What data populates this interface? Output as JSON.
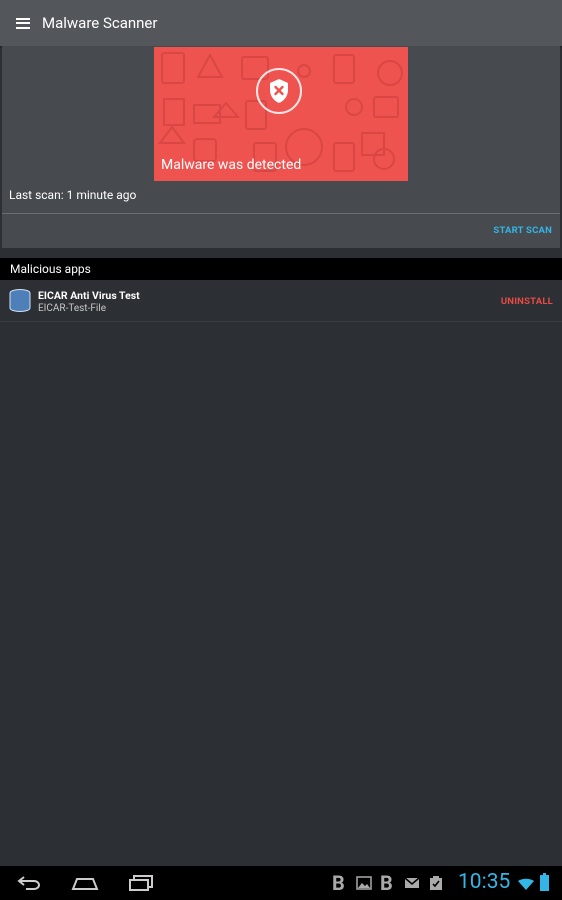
{
  "app_bar": {
    "title": "Malware Scanner",
    "menu_icon": "hamburger-menu-icon"
  },
  "status_card": {
    "banner_text": "Malware was detected",
    "banner_color": "#ef5350",
    "banner_icon": "shield-x-icon",
    "last_scan": "Last scan: 1 minute ago",
    "start_scan_label": "START SCAN",
    "accent_color": "#33b5e5"
  },
  "malicious_section": {
    "header": "Malicious apps",
    "items": [
      {
        "name": "EICAR Anti Virus Test",
        "detail": "EICAR-Test-File",
        "action": "UNINSTALL",
        "icon": "database-app-icon"
      }
    ],
    "danger_color": "#e84a45"
  },
  "system_bar": {
    "clock": "10:35",
    "nav_icons": [
      "back-icon",
      "home-icon",
      "recent-apps-icon"
    ],
    "notification_icons": [
      "bold-b-icon",
      "image-icon",
      "bold-b-icon",
      "gmail-icon",
      "clipboard-check-icon"
    ],
    "status_icons": [
      "wifi-icon",
      "battery-icon"
    ]
  }
}
